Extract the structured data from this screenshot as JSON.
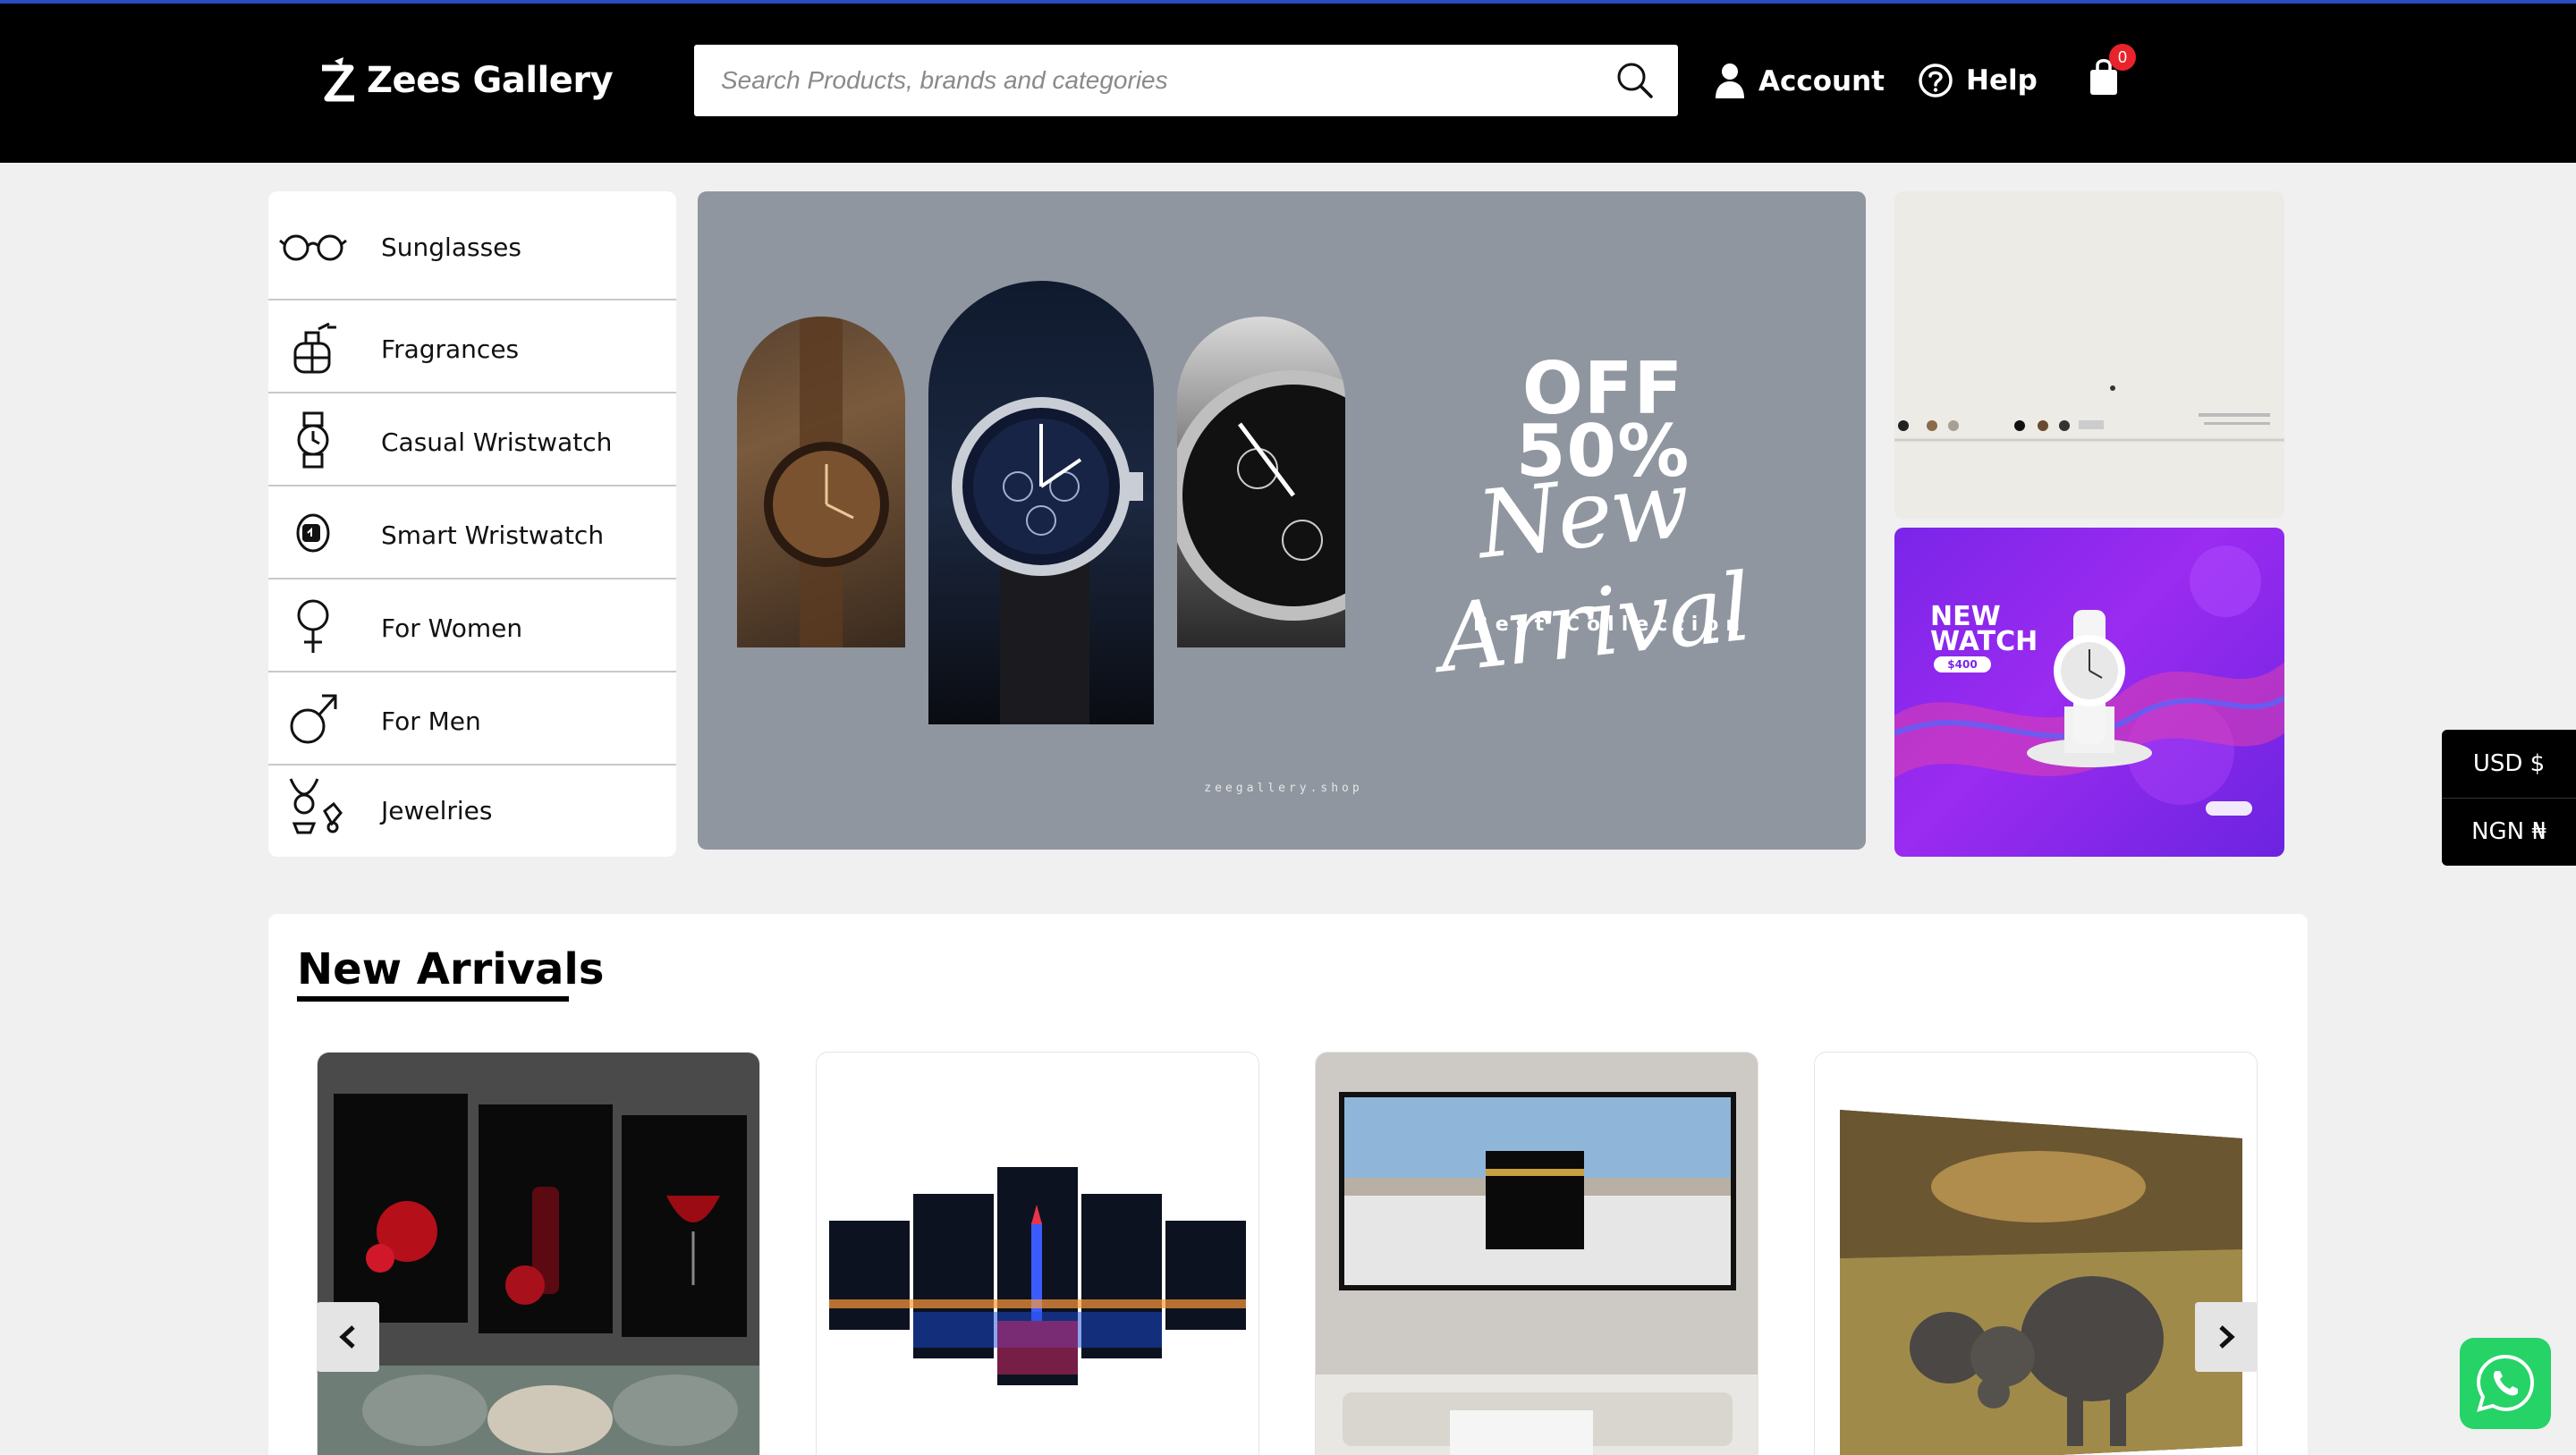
{
  "header": {
    "brand": "Zees Gallery",
    "search_placeholder": "Search Products, brands and categories",
    "account_label": "Account",
    "help_label": "Help",
    "cart_count": "0"
  },
  "categories": [
    {
      "label": "Sunglasses",
      "icon": "sunglasses-icon"
    },
    {
      "label": "Fragrances",
      "icon": "perfume-icon"
    },
    {
      "label": "Casual Wristwatch",
      "icon": "wristwatch-icon"
    },
    {
      "label": "Smart Wristwatch",
      "icon": "smartwatch-icon"
    },
    {
      "label": "For Women",
      "icon": "female-symbol-icon"
    },
    {
      "label": "For Men",
      "icon": "male-symbol-icon"
    },
    {
      "label": "Jewelries",
      "icon": "jewelry-icon"
    }
  ],
  "hero": {
    "line1": "OFF",
    "line2": "50%",
    "script": "New Arrival",
    "tagline": "Best Collection",
    "site": "zeegallery.shop"
  },
  "promo": {
    "title_line1": "NEW",
    "title_line2": "WATCH",
    "price": "$400"
  },
  "currency": {
    "options": [
      "USD $",
      "NGN ₦"
    ]
  },
  "new_arrivals": {
    "title": "New Arrivals",
    "products": [
      {
        "image": "wine-rose-triptych-canvas"
      },
      {
        "image": "city-skyline-five-panel-canvas"
      },
      {
        "image": "kaaba-mecca-framed-canvas"
      },
      {
        "image": "elephants-savanna-canvas"
      }
    ]
  },
  "colors": {
    "header_bg": "#000000",
    "accent_line": "#2b4bbf",
    "cart_badge": "#e8232b",
    "promo_purple": "#7a25e8",
    "whatsapp_green": "#25d366"
  }
}
